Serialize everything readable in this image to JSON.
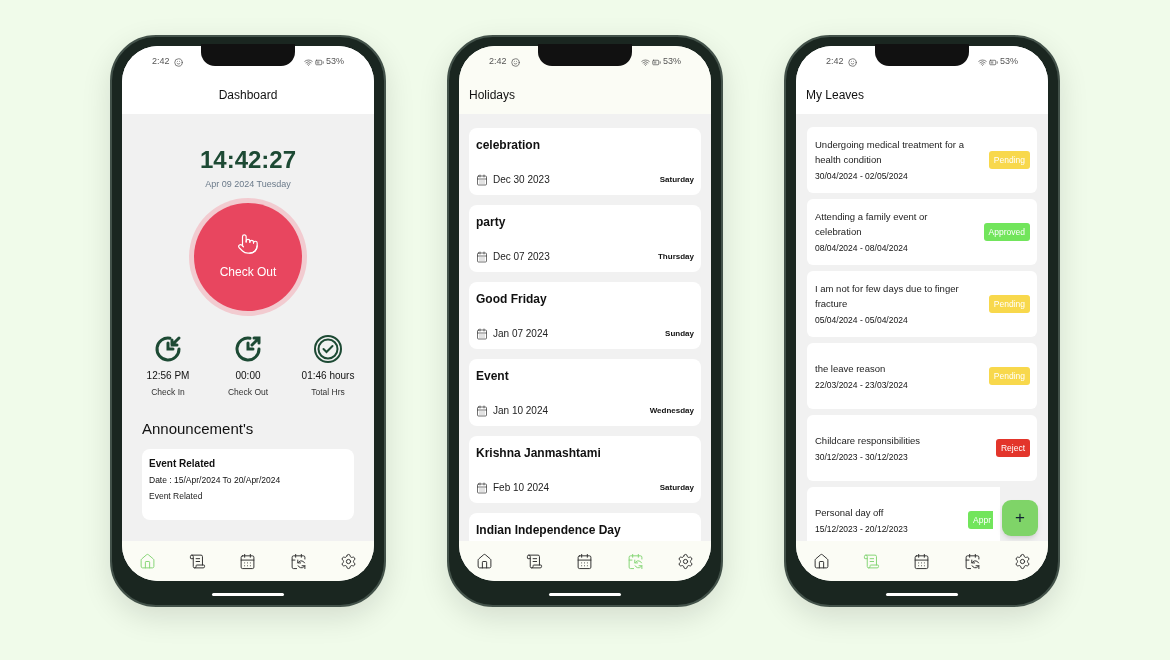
{
  "phones": [
    {
      "kind": "dashboard",
      "status_bar": {
        "time": "2:42",
        "battery": "53%"
      },
      "title": "Dashboard",
      "clock": {
        "time": "14:42:27",
        "date": "Apr 09 2024 Tuesday"
      },
      "action_button": "Check Out",
      "stats": [
        {
          "kind": "in",
          "value": "12:56 PM",
          "label": "Check In"
        },
        {
          "kind": "out",
          "value": "00:00",
          "label": "Check Out"
        },
        {
          "kind": "total",
          "value": "01:46 hours",
          "label": "Total Hrs"
        }
      ],
      "announcements": {
        "heading": "Announcement's",
        "items": [
          {
            "title": "Event Related",
            "date": "Date : 15/Apr/2024 To 20/Apr/2024",
            "body": "Event Related"
          }
        ]
      },
      "nav": [
        {
          "kind": "home",
          "selected": true
        },
        {
          "kind": "leaves",
          "selected": false
        },
        {
          "kind": "attendance",
          "selected": false
        },
        {
          "kind": "holidays",
          "selected": false
        },
        {
          "kind": "settings",
          "selected": false
        }
      ]
    },
    {
      "kind": "holidays",
      "status_bar": {
        "time": "2:42",
        "battery": "53%"
      },
      "title": "Holidays",
      "holidays": [
        {
          "name": "celebration",
          "date": "Dec 30 2023",
          "day": "Saturday"
        },
        {
          "name": "party",
          "date": "Dec 07 2023",
          "day": "Thursday"
        },
        {
          "name": "Good Friday",
          "date": "Jan 07 2024",
          "day": "Sunday"
        },
        {
          "name": "Event",
          "date": "Jan 10 2024",
          "day": "Wednesday"
        },
        {
          "name": "Krishna Janmashtami",
          "date": "Feb 10 2024",
          "day": "Saturday"
        },
        {
          "name": "Indian Independence Day"
        }
      ],
      "nav": [
        {
          "kind": "home",
          "selected": false
        },
        {
          "kind": "leaves",
          "selected": false
        },
        {
          "kind": "attendance",
          "selected": false
        },
        {
          "kind": "holidays",
          "selected": true
        },
        {
          "kind": "settings",
          "selected": false
        }
      ]
    },
    {
      "kind": "leaves",
      "status_bar": {
        "time": "2:42",
        "battery": "53%"
      },
      "title": "My Leaves",
      "leaves": [
        {
          "reason": "Undergoing medical treatment for a health condition",
          "dates": "30/04/2024 - 02/05/2024",
          "color": "#f8d84c",
          "label": "Pending"
        },
        {
          "reason": "Attending a family event or celebration",
          "dates": "08/04/2024 - 08/04/2024",
          "color": "#72e55c",
          "label": "Approved"
        },
        {
          "reason": "I am not for few days due to finger fracture",
          "dates": "05/04/2024 - 05/04/2024",
          "color": "#f8d84c",
          "label": "Pending"
        },
        {
          "reason": "the leave reason",
          "dates": "22/03/2024 - 23/03/2024",
          "color": "#f8d84c",
          "label": "Pending"
        },
        {
          "reason": "Childcare responsibilities",
          "dates": "30/12/2023 - 30/12/2023",
          "color": "#e3352b",
          "label": "Reject"
        },
        {
          "reason": "Personal day off",
          "dates": "15/12/2023 - 20/12/2023",
          "color": "#72e55c",
          "label": "Appr"
        }
      ],
      "fab": "+",
      "nav": [
        {
          "kind": "home",
          "selected": false
        },
        {
          "kind": "leaves",
          "selected": true
        },
        {
          "kind": "attendance",
          "selected": false
        },
        {
          "kind": "holidays",
          "selected": false
        },
        {
          "kind": "settings",
          "selected": false
        }
      ]
    }
  ]
}
